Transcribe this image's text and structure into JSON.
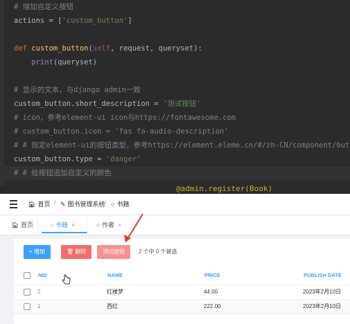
{
  "editor": {
    "lines": [
      [
        {
          "t": "# 增加自定义按钮",
          "c": "com"
        }
      ],
      [
        {
          "t": "actions = [",
          "c": "plain"
        },
        {
          "t": "'custom_button'",
          "c": "str"
        },
        {
          "t": "]",
          "c": "plain"
        }
      ],
      [],
      [
        {
          "t": "def ",
          "c": "kw"
        },
        {
          "t": "custom_button",
          "c": "fn"
        },
        {
          "t": "(",
          "c": "plain"
        },
        {
          "t": "self",
          "c": "self"
        },
        {
          "t": ", request, queryset):",
          "c": "plain"
        }
      ],
      [
        {
          "t": "    print",
          "c": "bi"
        },
        {
          "t": "(queryset)",
          "c": "plain"
        }
      ],
      [],
      [
        {
          "t": "# 显示的文本，与django admin一致",
          "c": "com"
        }
      ],
      [
        {
          "t": "custom_button.short_description = ",
          "c": "plain"
        },
        {
          "t": "'测试按钮'",
          "c": "str"
        }
      ],
      [
        {
          "t": "# icon，参考element-ui icon与https://fontawesome.com",
          "c": "com"
        }
      ],
      [
        {
          "t": "# custom_button.icon = 'fas fa-audio-description'",
          "c": "com"
        }
      ],
      [
        {
          "t": "# # 指定element-ui的按钮类型，参考https://element.eleme.cn/#/zh-CN/component/button",
          "c": "com"
        }
      ],
      [
        {
          "t": "custom_button.type = ",
          "c": "plain"
        },
        {
          "t": "'danger'",
          "c": "str"
        }
      ],
      [
        {
          "t": "# # 给按钮追加自定义的颜色",
          "c": "com"
        }
      ]
    ],
    "decorator": "@admin.register(Book)"
  },
  "breadcrumb": {
    "home": "首页",
    "system": "图书管理系统",
    "current": "书籍"
  },
  "tabs": [
    {
      "label": "首页",
      "icon": "home-icon",
      "closable": false,
      "active": false
    },
    {
      "label": "书籍",
      "icon": "circle-icon",
      "closable": true,
      "active": true
    },
    {
      "label": "作者",
      "icon": "circle-icon",
      "closable": true,
      "active": false
    }
  ],
  "toolbar": {
    "add_label": "增加",
    "delete_label": "删除",
    "test_label": "测试按钮",
    "selection_info": "2 个中 0 个被选"
  },
  "table": {
    "columns": [
      "NID",
      "NAME",
      "PRICE",
      "PUBLISH DATE"
    ],
    "rows": [
      {
        "nid": "2",
        "name": "红楼梦",
        "price": "44.00",
        "publish_date": "2023年2月10日"
      },
      {
        "nid": "1",
        "name": "西红",
        "price": "222.00",
        "publish_date": "2023年2月10日"
      }
    ]
  },
  "colors": {
    "primary": "#409eff",
    "danger": "#f56c6c",
    "editor_bg": "#2b2b2b",
    "annotation_arrow": "#e53935"
  }
}
